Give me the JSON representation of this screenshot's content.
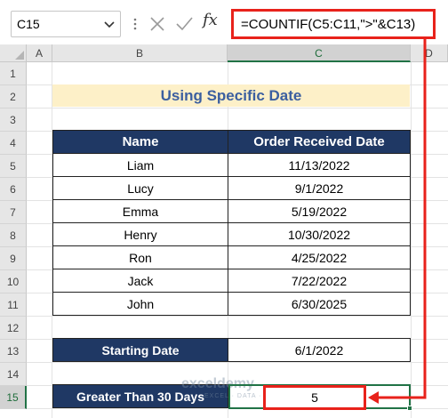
{
  "formula_bar": {
    "name_box": "C15",
    "formula": "=COUNTIF(C5:C11,\">\"&C13)"
  },
  "columns": [
    "A",
    "B",
    "C",
    "D"
  ],
  "rows": [
    "1",
    "2",
    "3",
    "4",
    "5",
    "6",
    "7",
    "8",
    "9",
    "10",
    "11",
    "12",
    "13",
    "14",
    "15"
  ],
  "title": "Using Specific Date",
  "table": {
    "headers": [
      "Name",
      "Order Received Date"
    ],
    "rows": [
      {
        "name": "Liam",
        "date": "11/13/2022"
      },
      {
        "name": "Lucy",
        "date": "9/1/2022"
      },
      {
        "name": "Emma",
        "date": "5/19/2022"
      },
      {
        "name": "Henry",
        "date": "10/30/2022"
      },
      {
        "name": "Ron",
        "date": "4/25/2022"
      },
      {
        "name": "Jack",
        "date": "7/22/2022"
      },
      {
        "name": "John",
        "date": "6/30/2025"
      }
    ]
  },
  "starting_date": {
    "label": "Starting Date",
    "value": "6/1/2022"
  },
  "result": {
    "label": "Greater Than 30 Days",
    "value": "5"
  },
  "watermark": {
    "brand": "exceldemy",
    "tagline": "EXCEL · DATA · BI"
  },
  "colors": {
    "header_fill": "#1f3864",
    "title_fill": "#fdf0c8",
    "title_text": "#3b5fa0",
    "highlight": "#e8221b",
    "selection": "#217346"
  }
}
